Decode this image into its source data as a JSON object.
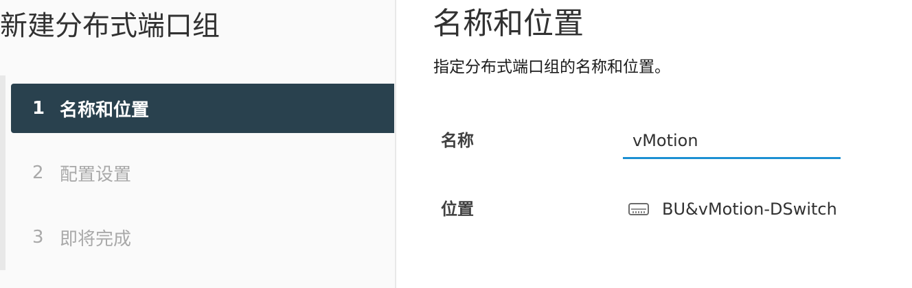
{
  "wizard": {
    "title": "新建分布式端口组",
    "steps": [
      {
        "number": "1",
        "label": "名称和位置"
      },
      {
        "number": "2",
        "label": "配置设置"
      },
      {
        "number": "3",
        "label": "即将完成"
      }
    ]
  },
  "content": {
    "title": "名称和位置",
    "description": "指定分布式端口组的名称和位置。",
    "name_field": {
      "label": "名称",
      "value": "vMotion"
    },
    "location_field": {
      "label": "位置",
      "value": "BU&vMotion-DSwitch",
      "icon": "distributed-switch-icon"
    }
  },
  "colors": {
    "active_step_bg": "#29414e",
    "input_underline": "#1b8fd2",
    "inactive_step_text": "#a9a9a9"
  }
}
